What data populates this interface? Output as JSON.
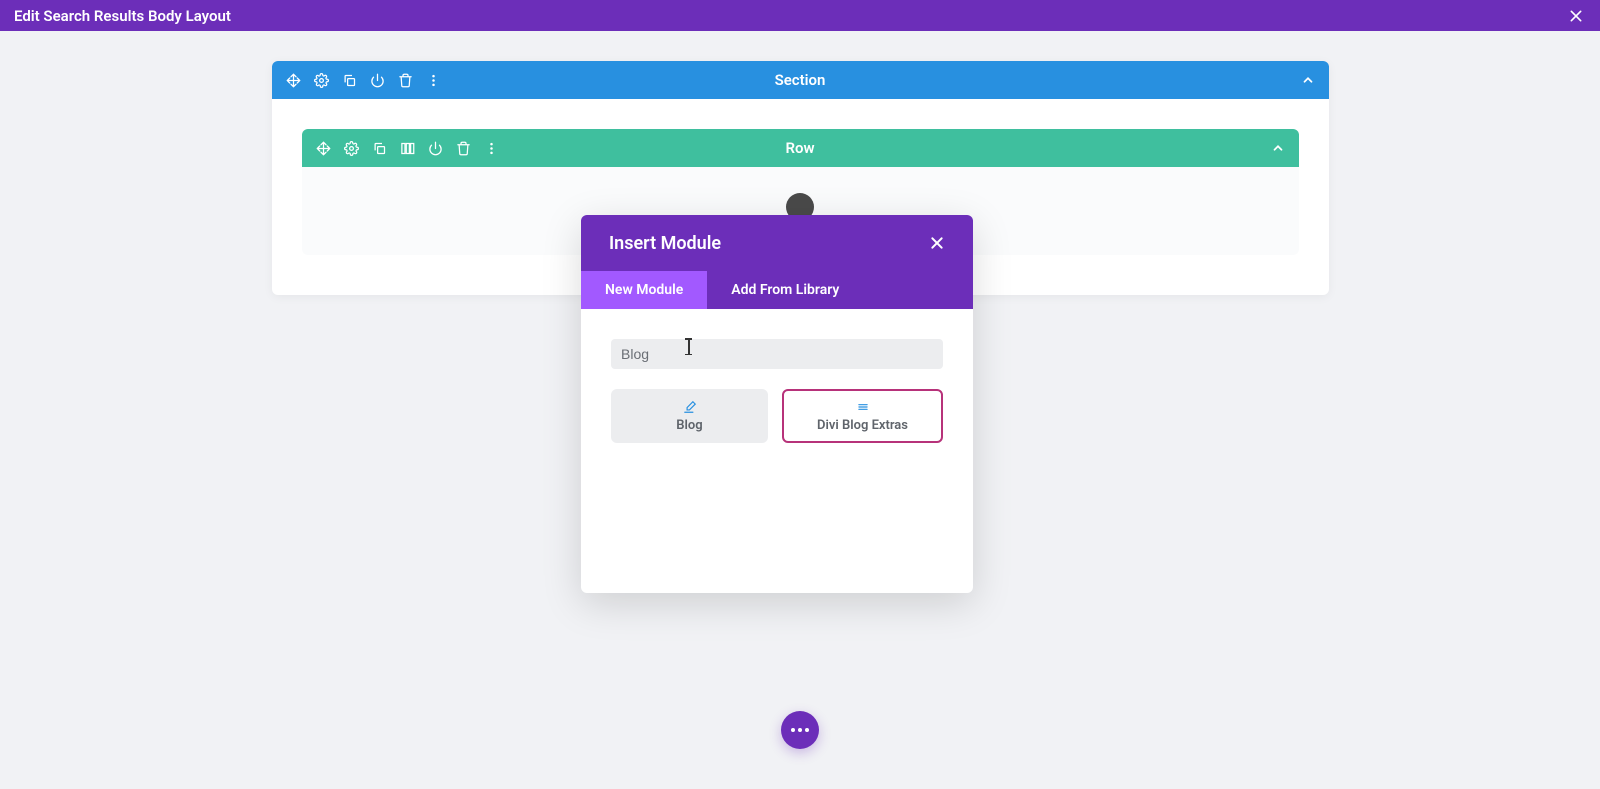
{
  "top_bar": {
    "title": "Edit Search Results Body Layout"
  },
  "section": {
    "label": "Section"
  },
  "row": {
    "label": "Row"
  },
  "modal": {
    "title": "Insert Module",
    "tabs": {
      "new": "New Module",
      "library": "Add From Library"
    },
    "search": {
      "value": "Blog"
    },
    "modules": {
      "blog": "Blog",
      "divi_blog_extras": "Divi Blog Extras"
    }
  }
}
